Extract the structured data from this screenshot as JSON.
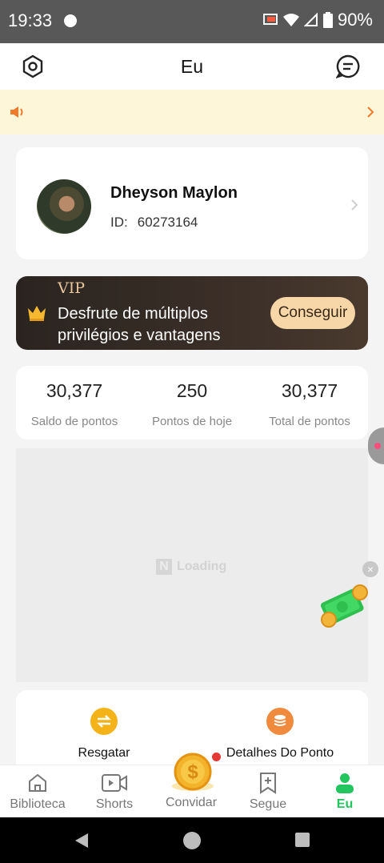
{
  "status_bar": {
    "time": "19:33",
    "battery": "90%"
  },
  "header": {
    "title": "Eu"
  },
  "profile": {
    "name": "Dheyson Maylon",
    "id_label": "ID:",
    "id_value": "60273164"
  },
  "vip": {
    "badge": "VIP",
    "text": "Desfrute de múltiplos privilégios e vantagens",
    "button": "Conseguir"
  },
  "stats": [
    {
      "value": "30,377",
      "label": "Saldo de pontos"
    },
    {
      "value": "250",
      "label": "Pontos de hoje"
    },
    {
      "value": "30,377",
      "label": "Total de pontos"
    }
  ],
  "ad": {
    "loading_text": "Loading",
    "logo_letter": "N"
  },
  "close_glyph": "×",
  "menu": [
    {
      "label": "Resgatar",
      "icon": "exchange-icon",
      "color": "#f5b31a"
    },
    {
      "label": "Detalhes Do Ponto",
      "icon": "coins-stack-icon",
      "color": "#f08a3c"
    }
  ],
  "tabs": [
    {
      "label": "Biblioteca",
      "icon": "house-icon"
    },
    {
      "label": "Shorts",
      "icon": "video-icon"
    },
    {
      "label": "Convidar",
      "icon": "gold-coin-icon"
    },
    {
      "label": "Segue",
      "icon": "bookmark-plus-icon"
    },
    {
      "label": "Eu",
      "icon": "person-icon",
      "active": true
    }
  ],
  "colors": {
    "accent": "#22c55e",
    "vip_gold": "#f7d6a8",
    "notice_bg": "#fdf6d8"
  }
}
